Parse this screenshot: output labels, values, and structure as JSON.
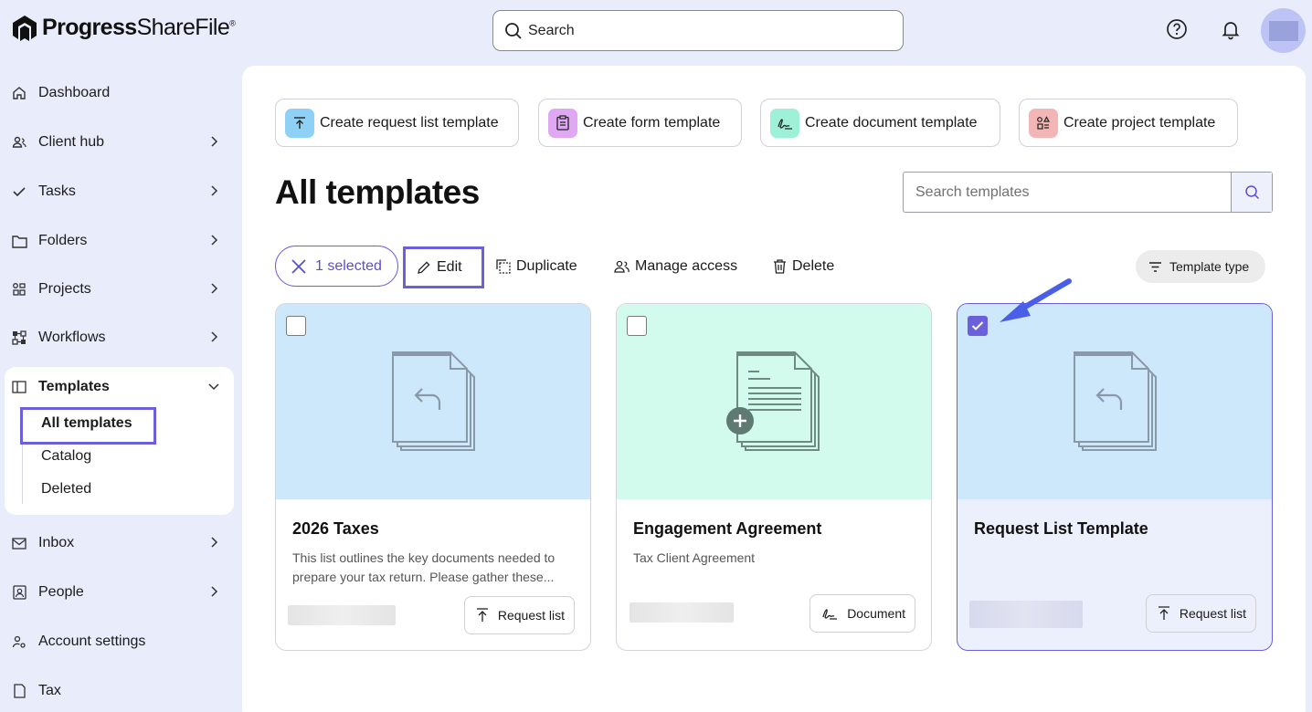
{
  "brand": {
    "name_bold": "Progress",
    "name_regular": "ShareFile",
    "trademark": "®"
  },
  "top_search": {
    "placeholder": "Search"
  },
  "sidebar": {
    "items": [
      {
        "label": "Dashboard",
        "icon": "home-icon"
      },
      {
        "label": "Client hub",
        "icon": "client-hub-icon"
      },
      {
        "label": "Tasks",
        "icon": "check-icon"
      },
      {
        "label": "Folders",
        "icon": "folder-icon"
      },
      {
        "label": "Projects",
        "icon": "projects-icon"
      },
      {
        "label": "Workflows",
        "icon": "workflows-icon"
      },
      {
        "label": "Templates",
        "icon": "templates-icon"
      },
      {
        "label": "Inbox",
        "icon": "inbox-icon"
      },
      {
        "label": "People",
        "icon": "people-icon"
      },
      {
        "label": "Account settings",
        "icon": "account-settings-icon"
      },
      {
        "label": "Tax",
        "icon": "tax-icon"
      }
    ],
    "templates_sub": [
      "All templates",
      "Catalog",
      "Deleted"
    ]
  },
  "create_buttons": [
    {
      "label": "Create request list template",
      "color": "#8fd0f7"
    },
    {
      "label": "Create form template",
      "color": "#e0a8f2"
    },
    {
      "label": "Create document template",
      "color": "#9ef0d6"
    },
    {
      "label": "Create project template",
      "color": "#f3b6b6"
    }
  ],
  "page_title": "All templates",
  "template_search": {
    "placeholder": "Search templates"
  },
  "toolbar": {
    "selected": "1 selected",
    "edit": "Edit",
    "duplicate": "Duplicate",
    "manage_access": "Manage access",
    "delete": "Delete",
    "template_type": "Template type"
  },
  "cards": [
    {
      "title": "2026 Taxes",
      "description": "This list outlines the key documents needed to prepare your tax return. Please gather these...",
      "tag": "Request list",
      "checked": false,
      "thumb_color": "#cde7fb"
    },
    {
      "title": "Engagement Agreement",
      "description": "Tax Client Agreement",
      "tag": "Document",
      "checked": false,
      "thumb_color": "#d2fbed"
    },
    {
      "title": "Request List Template",
      "description": "",
      "tag": "Request list",
      "checked": true,
      "thumb_color": "#cde7fb"
    }
  ],
  "accent_color": "#6b60d9"
}
